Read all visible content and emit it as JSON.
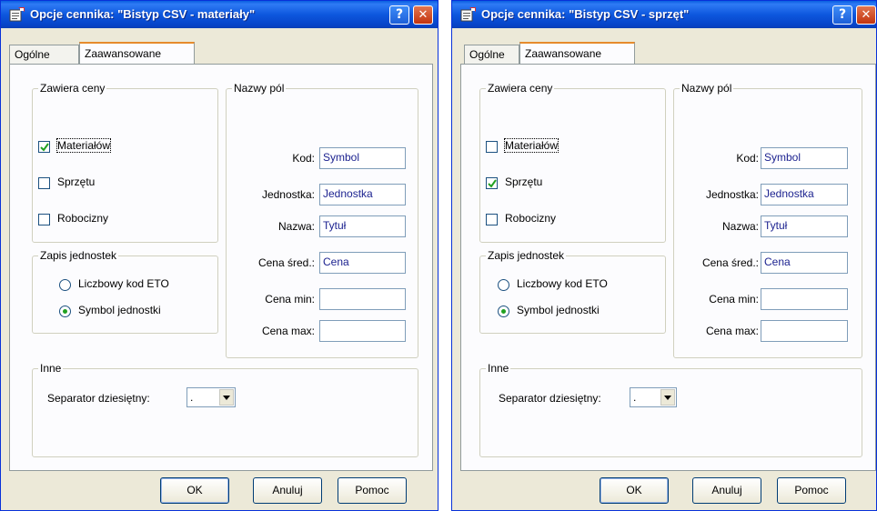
{
  "windows": [
    {
      "title": "Opcje cennika: \"Bistyp CSV - materiały\"",
      "tabs": [
        "Ogólne",
        "Zaawansowane"
      ],
      "active_tab": "Zaawansowane",
      "contains_prices": {
        "title": "Zawiera ceny",
        "items": [
          {
            "label": "Materiałów",
            "checked": true
          },
          {
            "label": "Sprzętu",
            "checked": false
          },
          {
            "label": "Robocizny",
            "checked": false
          }
        ]
      },
      "unit_format": {
        "title": "Zapis jednostek",
        "options": [
          {
            "label": "Liczbowy kod ETO",
            "selected": false
          },
          {
            "label": "Symbol jednostki",
            "selected": true
          }
        ]
      },
      "field_names": {
        "title": "Nazwy pól",
        "fields": [
          {
            "label": "Kod:",
            "value": "Symbol"
          },
          {
            "label": "Jednostka:",
            "value": "Jednostka"
          },
          {
            "label": "Nazwa:",
            "value": "Tytuł"
          },
          {
            "label": "Cena śred.:",
            "value": "Cena"
          },
          {
            "label": "Cena min:",
            "value": ""
          },
          {
            "label": "Cena max:",
            "value": ""
          }
        ]
      },
      "other": {
        "title": "Inne",
        "separator_label": "Separator dziesiętny:",
        "separator_value": "."
      },
      "buttons": {
        "ok": "OK",
        "cancel": "Anuluj",
        "help": "Pomoc"
      }
    },
    {
      "title": "Opcje cennika: \"Bistyp CSV - sprzęt\"",
      "tabs": [
        "Ogólne",
        "Zaawansowane"
      ],
      "active_tab": "Zaawansowane",
      "contains_prices": {
        "title": "Zawiera ceny",
        "items": [
          {
            "label": "Materiałów",
            "checked": false
          },
          {
            "label": "Sprzętu",
            "checked": true
          },
          {
            "label": "Robocizny",
            "checked": false
          }
        ]
      },
      "unit_format": {
        "title": "Zapis jednostek",
        "options": [
          {
            "label": "Liczbowy kod ETO",
            "selected": false
          },
          {
            "label": "Symbol jednostki",
            "selected": true
          }
        ]
      },
      "field_names": {
        "title": "Nazwy pól",
        "fields": [
          {
            "label": "Kod:",
            "value": "Symbol"
          },
          {
            "label": "Jednostka:",
            "value": "Jednostka"
          },
          {
            "label": "Nazwa:",
            "value": "Tytuł"
          },
          {
            "label": "Cena śred.:",
            "value": "Cena"
          },
          {
            "label": "Cena min:",
            "value": ""
          },
          {
            "label": "Cena max:",
            "value": ""
          }
        ]
      },
      "other": {
        "title": "Inne",
        "separator_label": "Separator dziesiętny:",
        "separator_value": "."
      },
      "buttons": {
        "ok": "OK",
        "cancel": "Anuluj",
        "help": "Pomoc"
      }
    }
  ],
  "icons": {
    "window_icon": "properties-icon",
    "help_button": "help-icon",
    "close_button": "close-icon",
    "dropdown": "chevron-down-icon"
  },
  "colors": {
    "titlebar": "#0b52d8",
    "dialog_bg": "#ece9d8",
    "field_text": "#1d2390",
    "active_tab_accent": "#e68b2c"
  }
}
